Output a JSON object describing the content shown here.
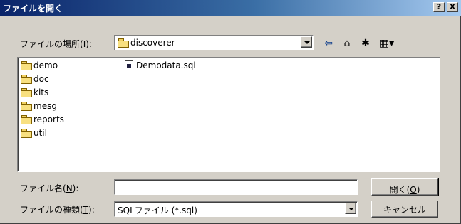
{
  "window": {
    "title": "ファイルを開く"
  },
  "titlebar": {
    "help_label": "?",
    "close_label": "X"
  },
  "location": {
    "label_prefix": "ファイルの場所(",
    "label_key": "I",
    "label_suffix": "):",
    "value": "discoverer"
  },
  "toolbar": {
    "back_glyph": "⇦",
    "up_glyph": "⌂",
    "newfolder_glyph": "✱",
    "view_glyph": "▦▾"
  },
  "files": {
    "folders": [
      "demo",
      "doc",
      "kits",
      "mesg",
      "reports",
      "util"
    ],
    "file": "Demodata.sql"
  },
  "filename": {
    "label_prefix": "ファイル名(",
    "label_key": "N",
    "label_suffix": "):",
    "value": ""
  },
  "filetype": {
    "label_prefix": "ファイルの種類(",
    "label_key": "T",
    "label_suffix": "):",
    "value": "SQLファイル (*.sql)"
  },
  "buttons": {
    "open_prefix": "開く(",
    "open_key": "O",
    "open_suffix": ")",
    "cancel": "キャンセル"
  }
}
